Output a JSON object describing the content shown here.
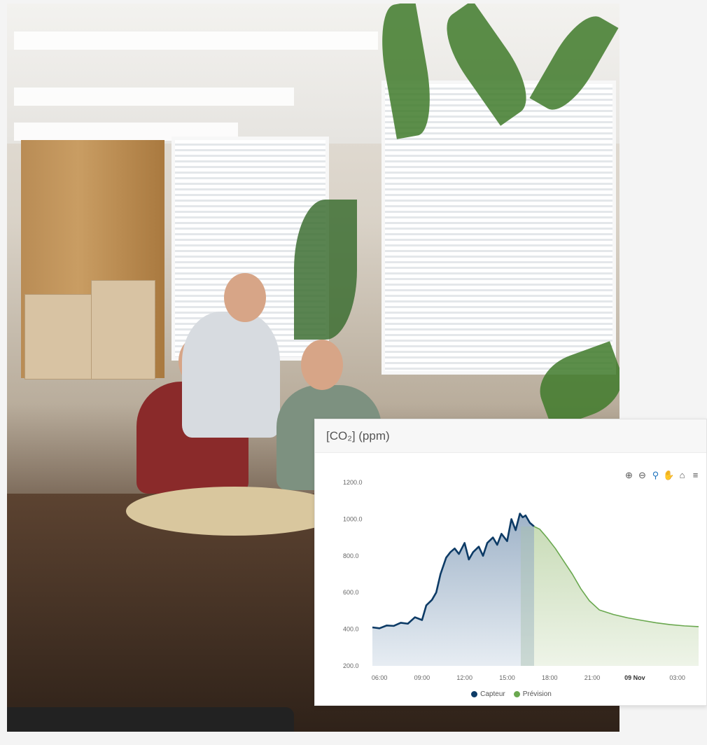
{
  "card": {
    "title": "[CO₂] (ppm)"
  },
  "toolbar": {
    "zoom_in": "⊕",
    "zoom_out": "⊖",
    "selection_zoom": "⚲",
    "pan": "✋",
    "reset": "⌂",
    "menu": "≡"
  },
  "chart_data": {
    "type": "area",
    "title": "[CO₂] (ppm)",
    "xlabel": "",
    "ylabel": "",
    "ylim": [
      200,
      1200
    ],
    "yticks": [
      "200.0",
      "400.0",
      "600.0",
      "800.0",
      "1000.0",
      "1200.0"
    ],
    "xtick_labels": [
      "06:00",
      "09:00",
      "12:00",
      "15:00",
      "18:00",
      "21:00",
      "09 Nov",
      "03:00"
    ],
    "xtick_hours": [
      6,
      9,
      12,
      15,
      18,
      21,
      24,
      27
    ],
    "xlim_hours": [
      5.5,
      28.5
    ],
    "legend_position": "bottom",
    "series": [
      {
        "name": "Capteur",
        "color": "#0d3b66",
        "x": [
          5.5,
          6.0,
          6.5,
          7.0,
          7.5,
          8.0,
          8.5,
          9.0,
          9.3,
          9.7,
          10.0,
          10.3,
          10.7,
          11.0,
          11.3,
          11.6,
          12.0,
          12.3,
          12.6,
          13.0,
          13.3,
          13.6,
          14.0,
          14.3,
          14.6,
          15.0,
          15.3,
          15.6,
          15.9,
          16.1,
          16.3,
          16.6,
          16.9
        ],
        "values": [
          410,
          405,
          420,
          418,
          435,
          430,
          465,
          450,
          530,
          560,
          600,
          700,
          790,
          820,
          840,
          810,
          870,
          780,
          820,
          850,
          800,
          870,
          900,
          860,
          920,
          880,
          1000,
          940,
          1030,
          1010,
          1020,
          980,
          960
        ]
      },
      {
        "name": "Prévision",
        "color": "#6aa84f",
        "x": [
          16.9,
          17.3,
          17.8,
          18.4,
          19.0,
          19.6,
          20.2,
          20.8,
          21.5,
          22.5,
          23.5,
          24.5,
          25.5,
          26.5,
          27.5,
          28.5
        ],
        "values": [
          960,
          945,
          900,
          840,
          770,
          700,
          620,
          555,
          505,
          480,
          462,
          448,
          435,
          425,
          418,
          414
        ]
      }
    ]
  }
}
